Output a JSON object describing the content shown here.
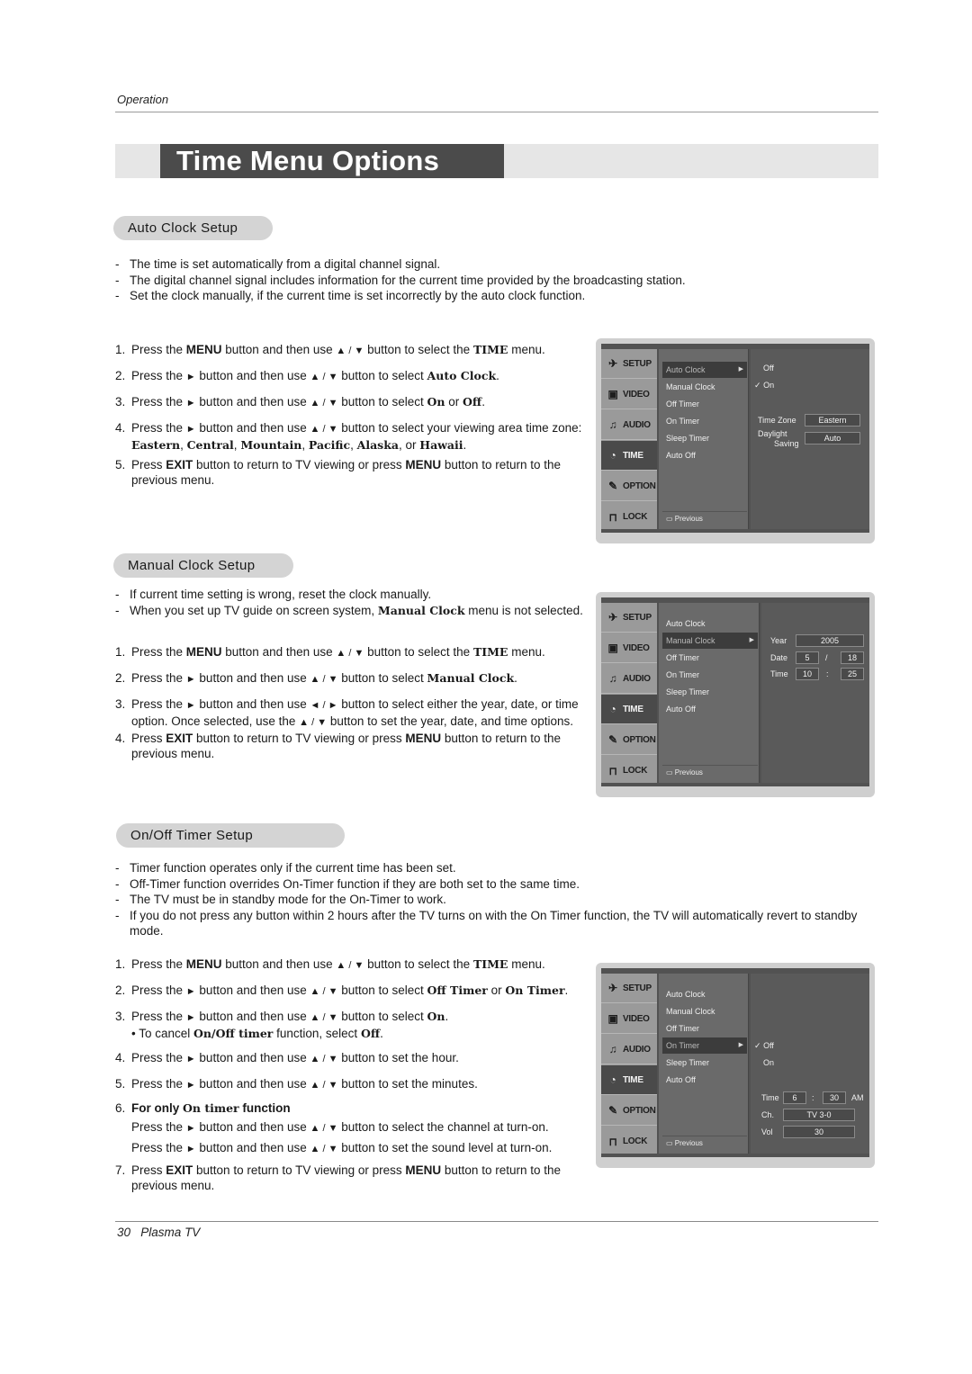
{
  "header": {
    "section": "Operation"
  },
  "title": "Time Menu Options",
  "footer": {
    "page_number": "30",
    "product": "Plasma TV"
  },
  "glyphs": {
    "up": "▲",
    "down": "▼",
    "right": "►",
    "left": "◄",
    "slash": " / "
  },
  "sections": {
    "auto_clock": {
      "heading": "Auto Clock Setup",
      "bullets": [
        "The time is set automatically from a digital channel signal.",
        "The digital channel signal includes information for the current time provided by the broadcasting station.",
        "Set the clock manually, if the current time is set incorrectly by the auto clock function."
      ],
      "steps": {
        "s1": {
          "n": "1.",
          "a": "Press the ",
          "menu": "MENU",
          "b": " button and then use ",
          "c": " button to select the ",
          "time": "TIME",
          "d": " menu."
        },
        "s2": {
          "n": "2.",
          "a": "Press the ",
          "b": " button and then use ",
          "c": " button to select ",
          "target": "Auto Clock",
          "d": "."
        },
        "s3": {
          "n": "3.",
          "a": "Press the ",
          "b": " button and then use ",
          "c": " button to select ",
          "on": "On",
          "or": " or ",
          "off": "Off",
          "d": "."
        },
        "s4": {
          "n": "4.",
          "a": "Press the ",
          "b": " button and then use ",
          "c": " button to select your viewing area time zone: ",
          "z1": "Eastern",
          "z2": "Central",
          "z3": "Mountain",
          "z4": "Pacific",
          "z5": "Alaska",
          "z6": "Hawaii",
          "comma": ", ",
          "or": ", or ",
          "d": "."
        },
        "s5": {
          "n": "5.",
          "a": "Press ",
          "exit": "EXIT",
          "b": " button to return to TV viewing or press ",
          "menu": "MENU",
          "c": " button to return to the previous menu."
        }
      },
      "menu": {
        "sidebar": [
          "SETUP",
          "VIDEO",
          "AUDIO",
          "TIME",
          "OPTION",
          "LOCK"
        ],
        "active_sidebar": "TIME",
        "items": [
          "Auto Clock",
          "Manual Clock",
          "Off Timer",
          "On Timer",
          "Sleep Timer",
          "Auto Off"
        ],
        "selected_item": "Auto Clock",
        "previous_label": "Previous",
        "options": [
          "Off",
          "On"
        ],
        "checked_option": "On",
        "time_zone_label": "Time Zone",
        "time_zone_value": "Eastern",
        "daylight_label_1": "Daylight",
        "daylight_label_2": "Saving",
        "daylight_value": "Auto",
        "check": "✓"
      }
    },
    "manual_clock": {
      "heading": "Manual Clock Setup",
      "bullets": [
        "If current time setting is wrong, reset the clock manually."
      ],
      "bullet2": {
        "a": "When you set up TV  guide on screen system, ",
        "bold": "Manual Clock",
        "b": " menu is not selected."
      },
      "steps": {
        "s1": {
          "n": "1.",
          "a": "Press the ",
          "menu": "MENU",
          "b": " button and then use ",
          "c": " button to select the ",
          "time": "TIME",
          "d": " menu."
        },
        "s2": {
          "n": "2.",
          "a": "Press the ",
          "b": " button and then use ",
          "c": " button to select ",
          "target": "Manual Clock",
          "d": "."
        },
        "s3": {
          "n": "3.",
          "a": "Press the ",
          "b": " button and then use ",
          "c": " button to select either the year, date, or time option. Once selected, use the ",
          "d": " button to set the year, date, and time options."
        },
        "s4": {
          "n": "4.",
          "a": "Press ",
          "exit": "EXIT",
          "b": " button to return to TV viewing or press ",
          "menu": "MENU",
          "c": " button to return to the previous menu."
        }
      },
      "menu": {
        "sidebar": [
          "SETUP",
          "VIDEO",
          "AUDIO",
          "TIME",
          "OPTION",
          "LOCK"
        ],
        "active_sidebar": "TIME",
        "items": [
          "Auto Clock",
          "Manual Clock",
          "Off Timer",
          "On Timer",
          "Sleep Timer",
          "Auto Off"
        ],
        "selected_item": "Manual Clock",
        "previous_label": "Previous",
        "year_label": "Year",
        "year_value": "2005",
        "date_label": "Date",
        "date_month": "5",
        "date_sep": "/",
        "date_day": "18",
        "time_label": "Time",
        "time_hour": "10",
        "time_sep": ":",
        "time_min": "25"
      }
    },
    "onoff_timer": {
      "heading": "On/Off Timer Setup",
      "bullets": [
        "Timer function operates only if the current time has been set.",
        "Off-Timer function overrides On-Timer function if they are both set to the same time.",
        "The TV must be in standby mode for the On-Timer to work.",
        "If you do not press any button within 2 hours after the TV turns on with the On Timer function, the TV will automatically revert to standby mode."
      ],
      "steps": {
        "s1": {
          "n": "1.",
          "a": "Press the ",
          "menu": "MENU",
          "b": " button and then use ",
          "c": " button to select the ",
          "time": "TIME",
          "d": " menu."
        },
        "s2": {
          "n": "2.",
          "a": "Press the ",
          "b": " button and then use ",
          "c": " button to select ",
          "t1": "Off Timer",
          "or": " or ",
          "t2": "On Timer",
          "d": "."
        },
        "s3": {
          "n": "3.",
          "a": "Press the ",
          "b": " button and then use ",
          "c": " button to select ",
          "on": "On",
          "d": ".",
          "note_a": "• To cancel ",
          "note_bold": "On/Off timer",
          "note_b": " function, select ",
          "note_off": "Off",
          "note_c": "."
        },
        "s4": {
          "n": "4.",
          "a": "Press the ",
          "b": " button and then use ",
          "c": " button to set the hour."
        },
        "s5": {
          "n": "5.",
          "a": "Press the ",
          "b": " button and then use ",
          "c": " button to set the minutes."
        },
        "s6": {
          "n": "6.",
          "heading_a": "For only ",
          "heading_bold": "On timer",
          "heading_b": " function",
          "l1a": "Press the ",
          "l1b": " button and then use ",
          "l1c": " button to select the channel at turn-on.",
          "l2a": "Press the ",
          "l2b": " button and then use ",
          "l2c": " button to set the sound level at turn-on."
        },
        "s7": {
          "n": "7.",
          "a": "Press ",
          "exit": "EXIT",
          "b": " button to return to TV viewing or press ",
          "menu": "MENU",
          "c": " button to return to the previous menu."
        }
      },
      "menu": {
        "sidebar": [
          "SETUP",
          "VIDEO",
          "AUDIO",
          "TIME",
          "OPTION",
          "LOCK"
        ],
        "active_sidebar": "TIME",
        "items": [
          "Auto Clock",
          "Manual Clock",
          "Off Timer",
          "On Timer",
          "Sleep Timer",
          "Auto Off"
        ],
        "selected_item": "On Timer",
        "previous_label": "Previous",
        "options": [
          "Off",
          "On"
        ],
        "checked_option": "Off",
        "check": "✓",
        "time_label": "Time",
        "time_hour": "6",
        "time_sep": ":",
        "time_min": "30",
        "ampm": "AM",
        "ch_label": "Ch.",
        "ch_value": "TV 3-0",
        "vol_label": "Vol",
        "vol_value": "30"
      }
    }
  },
  "colors": {
    "title_bg": "#4b4b4b",
    "title_band": "#e6e6e6",
    "pill": "#d4d4d4",
    "menu_dark": "#525252",
    "menu_side": "#9a9a9a"
  }
}
